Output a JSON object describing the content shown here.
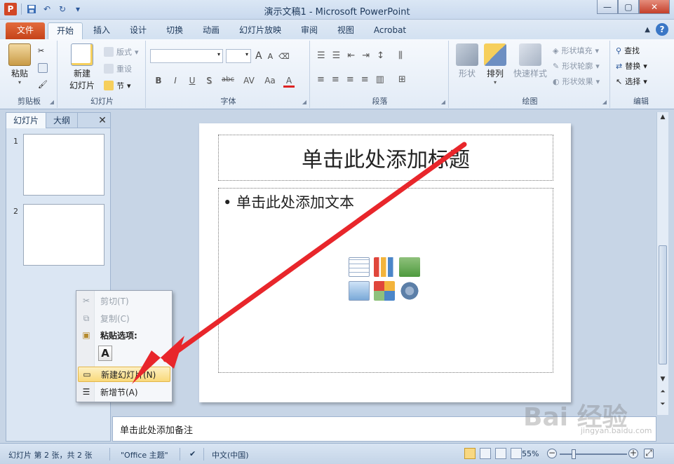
{
  "window": {
    "title": "演示文稿1 - Microsoft PowerPoint",
    "app_badge": "P"
  },
  "tabs": [
    {
      "label": "文件"
    },
    {
      "label": "开始"
    },
    {
      "label": "插入"
    },
    {
      "label": "设计"
    },
    {
      "label": "切换"
    },
    {
      "label": "动画"
    },
    {
      "label": "幻灯片放映"
    },
    {
      "label": "审阅"
    },
    {
      "label": "视图"
    },
    {
      "label": "Acrobat"
    }
  ],
  "ribbon": {
    "clipboard": {
      "label": "剪贴板",
      "paste": "粘贴"
    },
    "slides": {
      "label": "幻灯片",
      "new_slide_1": "新建",
      "new_slide_2": "幻灯片",
      "layout": "版式",
      "reset": "重设",
      "section": "节"
    },
    "font": {
      "label": "字体",
      "size_up": "A",
      "size_down": "A",
      "bold": "B",
      "italic": "I",
      "underline": "U",
      "shadow": "S",
      "strike": "abc",
      "spacing": "AV",
      "case": "Aa",
      "color": "A"
    },
    "paragraph": {
      "label": "段落"
    },
    "drawing": {
      "label": "绘图",
      "shapes": "形状",
      "arrange": "排列",
      "quick_styles": "快速样式",
      "shape_fill": "形状填充",
      "shape_outline": "形状轮廓",
      "shape_effects": "形状效果"
    },
    "editing": {
      "label": "编辑",
      "find": "查找",
      "replace": "替换",
      "select": "选择"
    }
  },
  "left_pane": {
    "tab_slides": "幻灯片",
    "tab_outline": "大纲",
    "close": "✕",
    "thumbnails": [
      {
        "num": "1"
      },
      {
        "num": "2"
      }
    ]
  },
  "slide": {
    "title_placeholder": "单击此处添加标题",
    "body_placeholder": "• 单击此处添加文本"
  },
  "notes": {
    "placeholder": "单击此处添加备注"
  },
  "context_menu": {
    "cut": "剪切(T)",
    "copy": "复制(C)",
    "paste_options": "粘贴选项:",
    "paste_keep_text": "A",
    "new_slide": "新建幻灯片(N)",
    "new_section": "新增节(A)"
  },
  "status_bar": {
    "slide_info": "幻灯片 第 2 张，共 2 张",
    "theme": "\"Office 主题\"",
    "language": "中文(中国)",
    "zoom": "55%",
    "zoom_level_percent": 55
  },
  "watermark": {
    "text": "Bai  经验",
    "sub": "jingyan.baidu.com"
  },
  "colors": {
    "file_tab": "#d24726",
    "arrow": "#e8262b",
    "highlight": "#f9d97a"
  }
}
